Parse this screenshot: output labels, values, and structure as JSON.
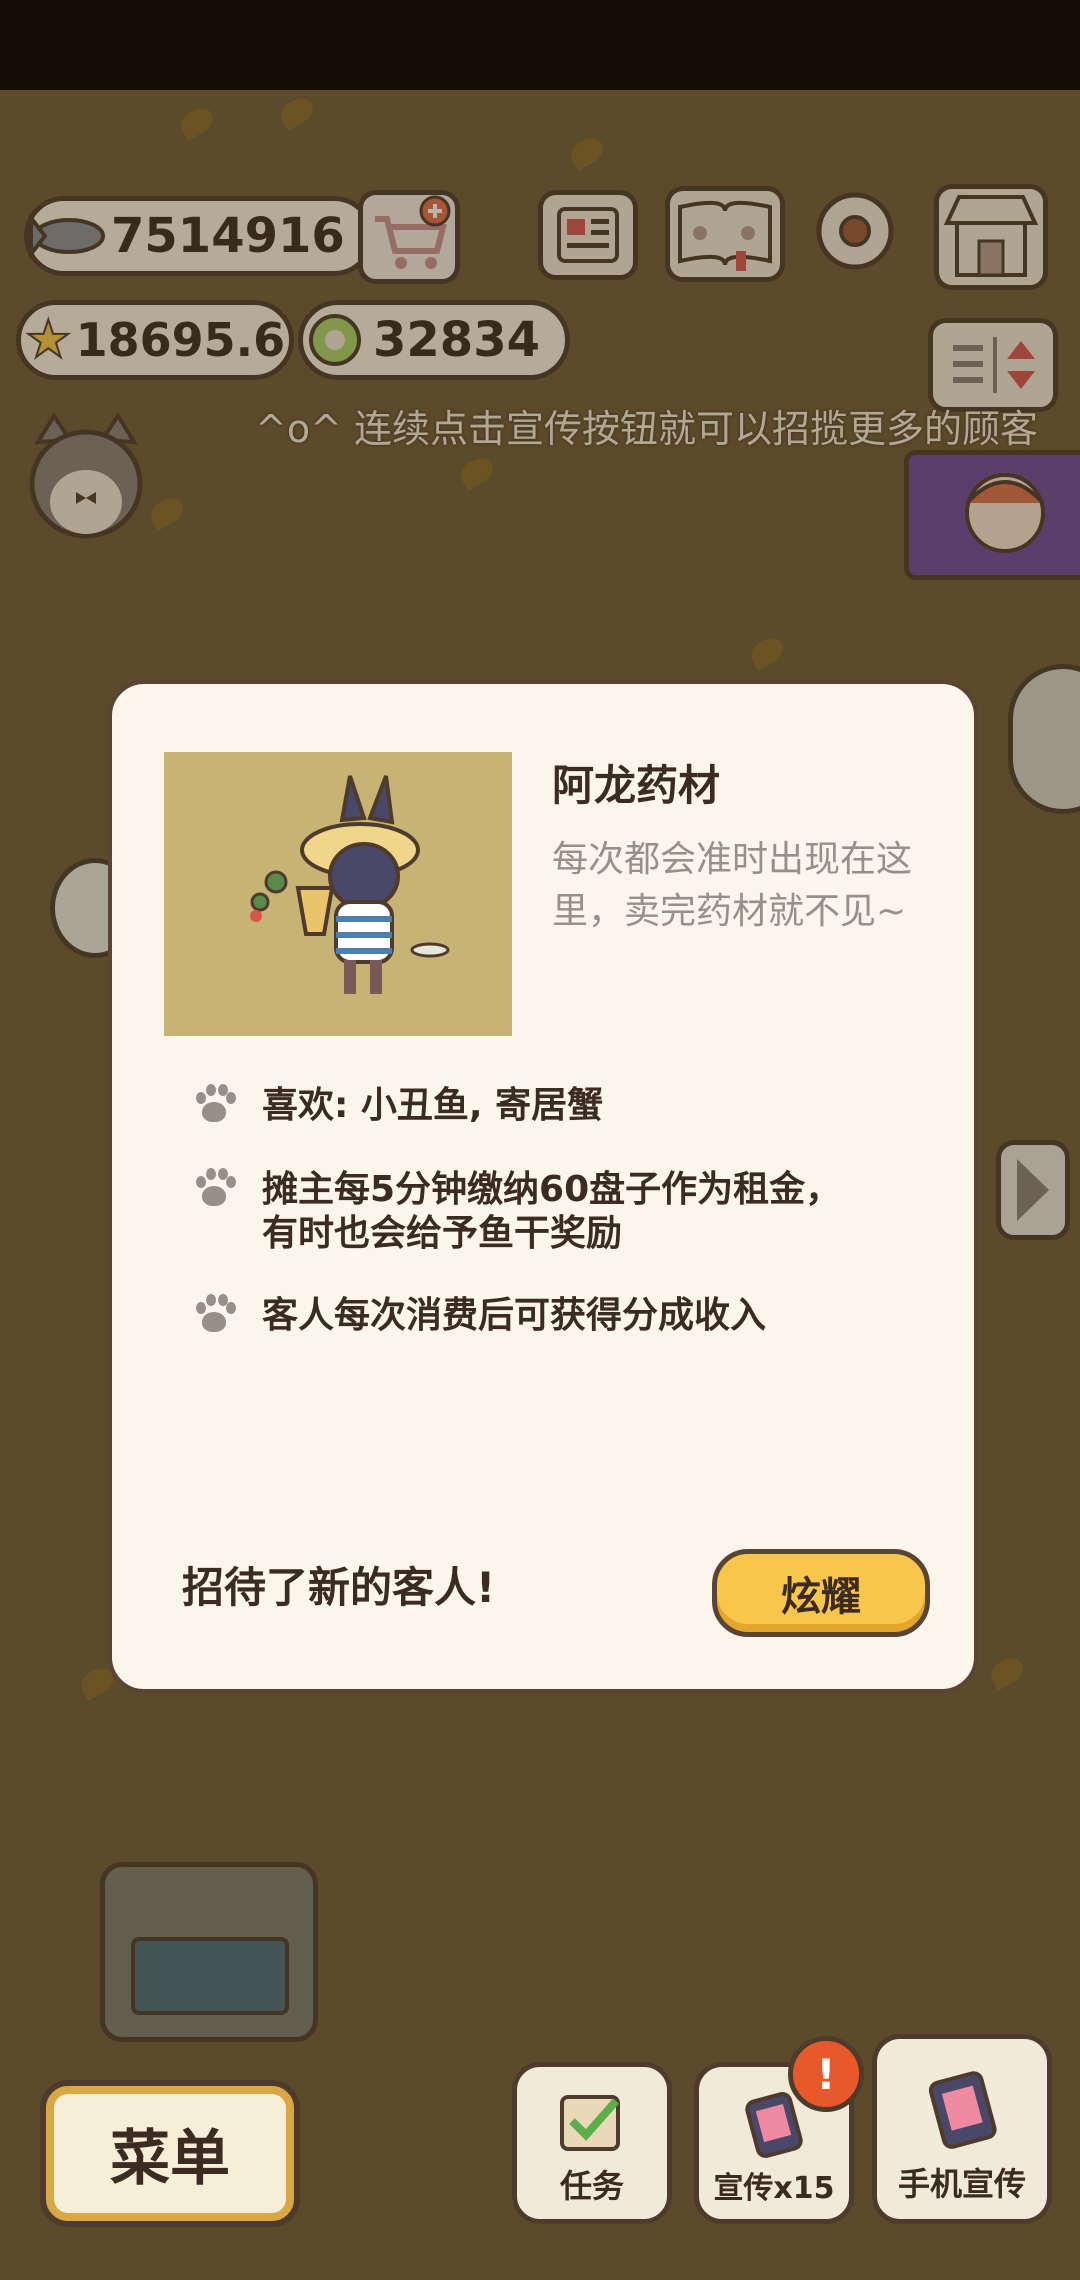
{
  "hud": {
    "fish_count": "7514916",
    "star_count": "18695.6",
    "coin_count": "32834",
    "hint": "^o^ 连续点击宣传按钮就可以招揽更多的顾客"
  },
  "dialog": {
    "name": "阿龙药材",
    "description": "每次都会准时出现在这里，卖完药材就不见~",
    "traits": [
      "喜欢: 小丑鱼, 寄居蟹",
      "摊主每5分钟缴纳60盘子作为租金，有时也会给予鱼干奖励",
      "客人每次消费后可获得分成收入"
    ],
    "footer": "招待了新的客人!",
    "show_button": "炫耀"
  },
  "bottom": {
    "menu": "菜单",
    "tasks": "任务",
    "promote": "宣传x15",
    "phone_promote": "手机宣传",
    "badge": "!"
  },
  "colors": {
    "background": "#6f5d36",
    "dialog_bg": "#fbf5ec",
    "accent_yellow": "#f8c64a",
    "border": "#4e3b2c"
  }
}
